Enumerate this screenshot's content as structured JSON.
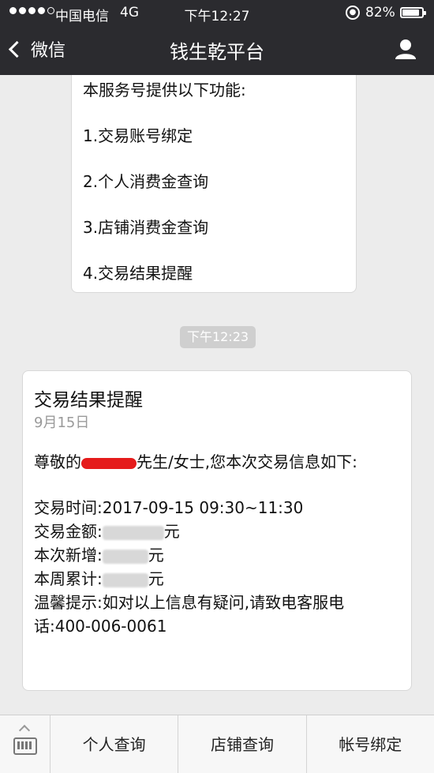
{
  "status": {
    "carrier": "中国电信",
    "network": "4G",
    "time": "下午12:27",
    "battery": "82%"
  },
  "nav": {
    "back_label": "微信",
    "title": "钱生乾平台"
  },
  "bubble": {
    "lines": [
      "本服务号提供以下功能:",
      "1.交易账号绑定",
      "2.个人消费金查询",
      "3.店铺消费金查询",
      "4.交易结果提醒"
    ]
  },
  "time_chip": "下午12:23",
  "card": {
    "title": "交易结果提醒",
    "date": "9月15日",
    "greeting_pre": "尊敬的",
    "greeting_post": "先生/女士,您本次交易信息如下:",
    "time_label": "交易时间:",
    "time_value": "2017-09-15 09:30~11:30",
    "amount_label": "交易金额:",
    "added_label": "本次新增:",
    "weekly_label": "本周累计:",
    "yuan": "元",
    "tip": "温馨提示:如对以上信息有疑问,请致电客服电话:400-006-0061"
  },
  "menu": {
    "items": [
      "个人查询",
      "店铺查询",
      "帐号绑定"
    ]
  }
}
